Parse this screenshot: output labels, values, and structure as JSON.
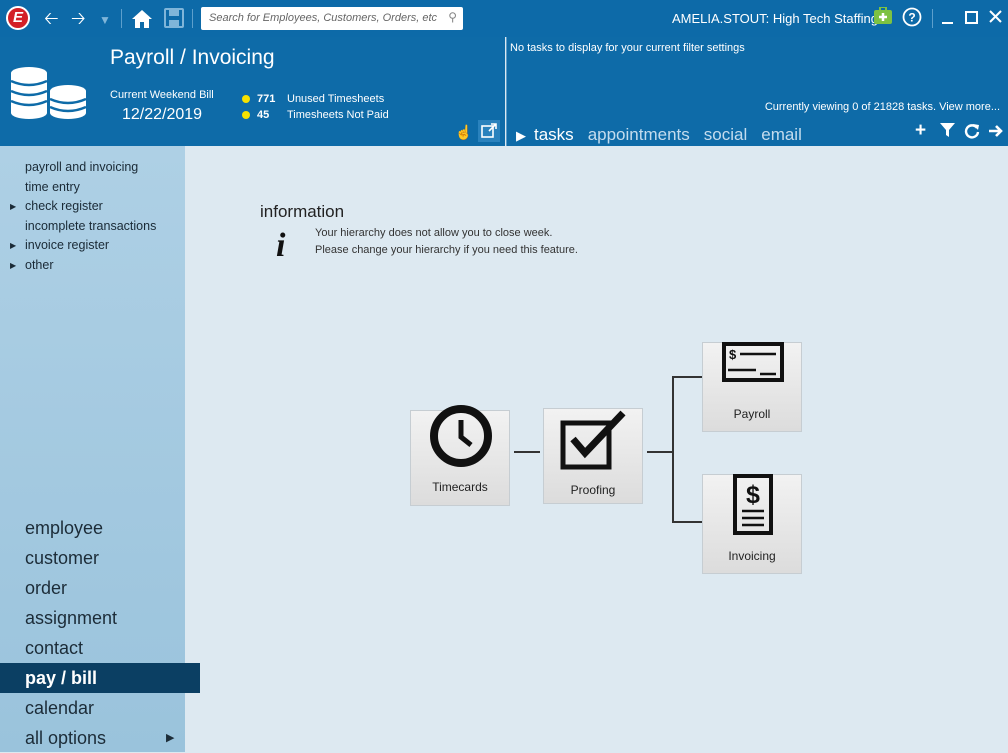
{
  "topbar": {
    "logo_letter": "E",
    "search_placeholder": "Search for Employees, Customers, Orders, etc.",
    "user_label": "AMELIA.STOUT: High Tech Staffing"
  },
  "header": {
    "title": "Payroll / Invoicing",
    "current_weekend_bill_label": "Current Weekend Bill",
    "current_weekend_bill_date": "12/22/2019",
    "stats": [
      {
        "count": "771",
        "label": "Unused Timesheets"
      },
      {
        "count": "45",
        "label": "Timesheets Not Paid"
      }
    ]
  },
  "tasks_panel": {
    "message": "No tasks to display for your current filter settings",
    "viewing": "Currently viewing 0 of 21828 tasks. View more...",
    "tabs": [
      "tasks",
      "appointments",
      "social",
      "email"
    ]
  },
  "sidebar": {
    "sub_items": [
      {
        "label": "payroll and invoicing",
        "expandable": false
      },
      {
        "label": "time entry",
        "expandable": false
      },
      {
        "label": "check register",
        "expandable": true
      },
      {
        "label": "incomplete transactions",
        "expandable": false
      },
      {
        "label": "invoice register",
        "expandable": true
      },
      {
        "label": "other",
        "expandable": true
      }
    ],
    "main_items": [
      "employee",
      "customer",
      "order",
      "assignment",
      "contact",
      "pay / bill",
      "calendar",
      "all options"
    ],
    "active_item": "pay / bill"
  },
  "info": {
    "title": "information",
    "message": "Your hierarchy does not allow you to close week. Please change your hierarchy if you need this feature."
  },
  "workflow": {
    "timecards": "Timecards",
    "proofing": "Proofing",
    "payroll": "Payroll",
    "invoicing": "Invoicing"
  },
  "colors": {
    "header_blue": "#0e6ba8",
    "sidebar": "#a6cbe1",
    "active_nav": "#0b3f63",
    "content_bg": "#dde9f1"
  }
}
